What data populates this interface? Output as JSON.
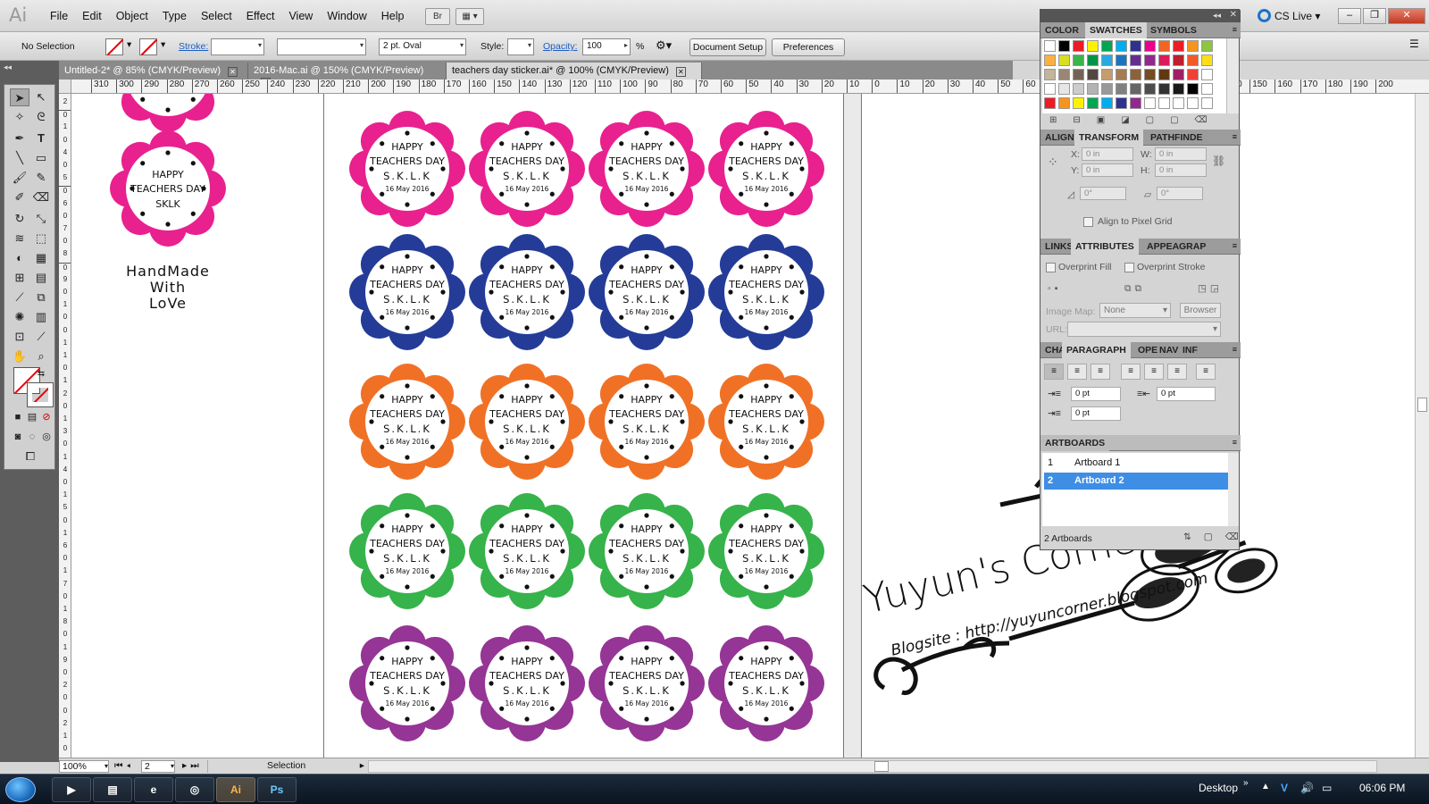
{
  "app": {
    "logo": "Ai"
  },
  "menu": [
    "File",
    "Edit",
    "Object",
    "Type",
    "Select",
    "Effect",
    "View",
    "Window",
    "Help"
  ],
  "menubar": {
    "bridge_label": "Br",
    "cslive": "CS Live"
  },
  "control": {
    "selection": "No Selection",
    "stroke_label": "Stroke:",
    "brush_value": "2 pt. Oval",
    "style_label": "Style:",
    "opacity_label": "Opacity:",
    "opacity_value": "100",
    "opacity_unit": "%",
    "doc_setup": "Document Setup",
    "preferences": "Preferences"
  },
  "tabs": [
    {
      "label": "Untitled-2* @ 85% (CMYK/Preview)"
    },
    {
      "label": "2016-Mac.ai @ 150% (CMYK/Preview)"
    },
    {
      "label": "teachers day sticker.ai* @ 100% (CMYK/Preview)"
    }
  ],
  "ruler_ticks": [
    "310",
    "300",
    "290",
    "280",
    "270",
    "260",
    "250",
    "240",
    "230",
    "220",
    "210",
    "200",
    "190",
    "180",
    "170",
    "160",
    "150",
    "140",
    "130",
    "120",
    "110",
    "100",
    "90",
    "80",
    "70",
    "60",
    "50",
    "40",
    "30",
    "20",
    "10",
    "0",
    "10",
    "20",
    "30",
    "40",
    "50",
    "60",
    "70",
    "80",
    "90",
    "100",
    "110",
    "120",
    "130",
    "140",
    "150",
    "160",
    "170",
    "180",
    "190",
    "200"
  ],
  "ruler_left_digits": [
    "2",
    "0",
    "1",
    "0",
    "4",
    "0",
    "5",
    "0",
    "6",
    "0",
    "7",
    "0",
    "8",
    "0",
    "9",
    "0",
    "1",
    "0",
    "0",
    "1",
    "1",
    "0",
    "1",
    "2",
    "0",
    "1",
    "3",
    "0",
    "1",
    "4",
    "0",
    "1",
    "5",
    "0",
    "1",
    "6",
    "0",
    "1",
    "7",
    "0",
    "1",
    "8",
    "0",
    "1",
    "9",
    "0",
    "2",
    "0",
    "0",
    "2",
    "1",
    "0"
  ],
  "sticker": {
    "line1": "HAPPY",
    "line2": "TEACHERS DAY",
    "line3": "S.K.L.K",
    "line4": "16 May 2016",
    "preview_line3": "SKLK",
    "colors": {
      "pink": "#e8218f",
      "blue": "#243c98",
      "orange": "#f07126",
      "green": "#36b34a",
      "purple": "#953595"
    },
    "row_colors": [
      "pink",
      "blue",
      "orange",
      "green",
      "purple"
    ]
  },
  "handmade": [
    "HandMade",
    "With",
    "LoVe"
  ],
  "watermark": {
    "title": "Yuyun's Corner",
    "blog": "Blogsite : http://yuyuncorner.blogspot.com"
  },
  "panel": {
    "color_tabs": [
      "COLOR",
      "SWATCHES",
      "SYMBOLS"
    ],
    "swatch_rows": [
      [
        "#ffffff",
        "#000000",
        "#ec1c24",
        "#fff200",
        "#00a651",
        "#00aeef",
        "#2e3192",
        "#ec008c",
        "#f26522",
        "#ed1c24",
        "#f7941d",
        "#8dc63f"
      ],
      [
        "#fbb040",
        "#d7df23",
        "#39b54a",
        "#009444",
        "#27aae1",
        "#1c75bc",
        "#662d91",
        "#92278f",
        "#da1c5c",
        "#be1e2d",
        "#f15a29",
        "#ffde17"
      ],
      [
        "#c2b59b",
        "#998675",
        "#736357",
        "#534741",
        "#c69c6d",
        "#a67c52",
        "#8c6239",
        "#754c24",
        "#603913",
        "#9e1f63",
        "#ef4136",
        "#fff"
      ],
      [
        "#ffffff",
        "#e6e6e6",
        "#cccccc",
        "#b3b3b3",
        "#999999",
        "#808080",
        "#666666",
        "#4d4d4d",
        "#333333",
        "#1a1a1a",
        "#000000",
        "#ffffff"
      ],
      [
        "#ed1c24",
        "#f7941d",
        "#fff200",
        "#00a651",
        "#00aeef",
        "#2e3192",
        "#92278f",
        "#ffffff",
        "#ffffff",
        "#ffffff",
        "#ffffff",
        "#ffffff"
      ]
    ],
    "transform_tabs": [
      "ALIGN",
      "TRANSFORM",
      "PATHFINDE"
    ],
    "transform": {
      "x_label": "X:",
      "y_label": "Y:",
      "w_label": "W:",
      "h_label": "H:",
      "x": "0 in",
      "y": "0 in",
      "w": "0 in",
      "h": "0 in",
      "rot": "0°",
      "shear": "0°",
      "pixel_grid": "Align to Pixel Grid"
    },
    "attr_tabs": [
      "LINKS",
      "ATTRIBUTES",
      "APPEA",
      "GRAP"
    ],
    "attributes": {
      "overprint_fill": "Overprint Fill",
      "overprint_stroke": "Overprint Stroke",
      "image_map_label": "Image Map:",
      "image_map_value": "None",
      "browser": "Browser",
      "url_label": "URL:"
    },
    "para_tabs": [
      "CHA",
      "PARAGRAPH",
      "OPE",
      "NAV",
      "INF"
    ],
    "paragraph": {
      "left_indent": "0 pt",
      "right_indent": "0 pt",
      "first_indent": "0 pt"
    },
    "artboards_title": "ARTBOARDS",
    "artboards": [
      {
        "num": "1",
        "name": "Artboard 1"
      },
      {
        "num": "2",
        "name": "Artboard 2"
      }
    ],
    "artboards_count": "2 Artboards"
  },
  "status": {
    "zoom": "100%",
    "page": "2",
    "tool": "Selection"
  },
  "taskbar": {
    "ai": "Ai",
    "ps": "Ps",
    "desktop": "Desktop",
    "time": "06:06 PM"
  }
}
